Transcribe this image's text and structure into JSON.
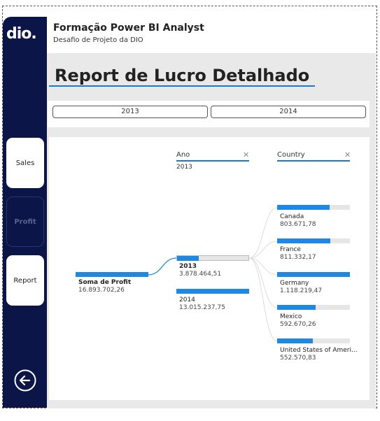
{
  "header": {
    "title": "Formação Power BI Analyst",
    "subtitle": "Desafio de Projeto da DIO"
  },
  "sidebar": {
    "logo": "dio.",
    "items": [
      {
        "label": "Sales"
      },
      {
        "label": "Profit"
      },
      {
        "label": "Report"
      }
    ]
  },
  "report": {
    "title": "Report de Lucro Detalhado"
  },
  "slicer": {
    "years": [
      "2013",
      "2014"
    ]
  },
  "tree": {
    "levels": [
      {
        "name": "Ano",
        "selected": "2013"
      },
      {
        "name": "Country"
      }
    ],
    "root": {
      "label": "Soma de Profit",
      "value": "16.893.702,26"
    },
    "years": [
      {
        "label": "2013",
        "value": "3.878.464,51",
        "fraction": 0.3
      },
      {
        "label": "2014",
        "value": "13.015.237,75",
        "fraction": 1.0
      }
    ],
    "countries": [
      {
        "label": "Canada",
        "value": "803.671,78",
        "fraction": 0.72
      },
      {
        "label": "France",
        "value": "811.332,17",
        "fraction": 0.73
      },
      {
        "label": "Germany",
        "value": "1.118.219,47",
        "fraction": 1.0
      },
      {
        "label": "Mexico",
        "value": "592.670,26",
        "fraction": 0.53
      },
      {
        "label": "United States of Ameri...",
        "value": "552.570,83",
        "fraction": 0.49
      }
    ]
  }
}
